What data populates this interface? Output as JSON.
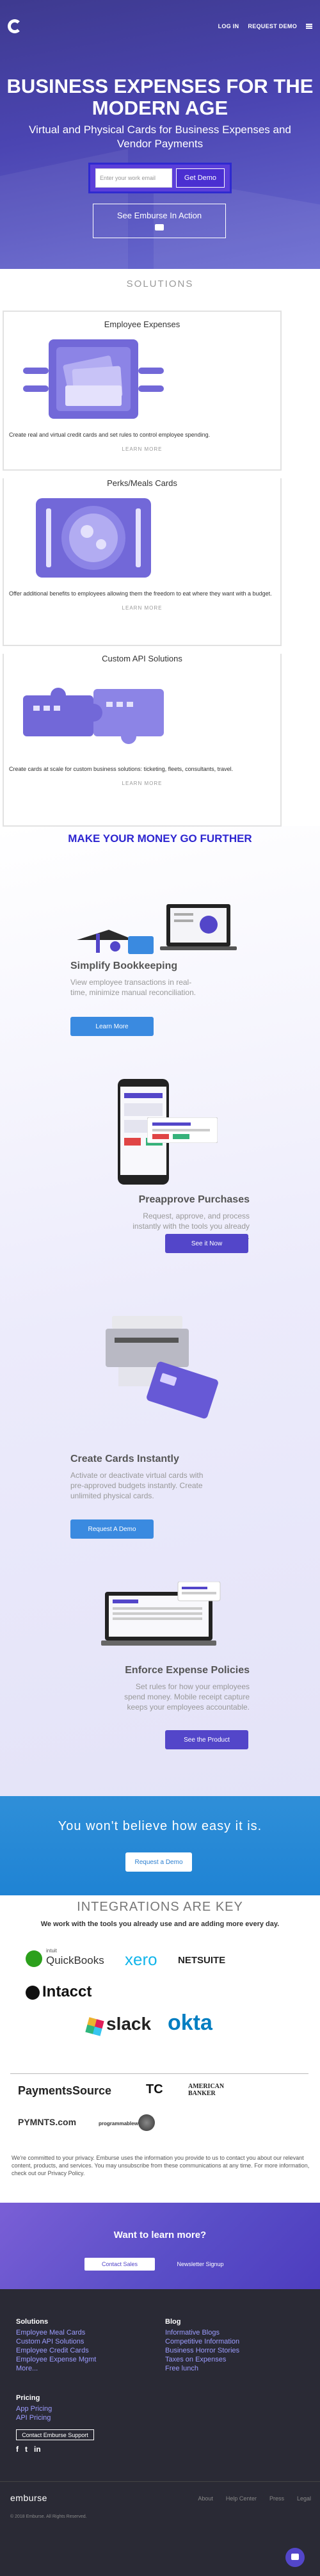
{
  "nav": {
    "login": "LOG IN",
    "request_demo": "REQUEST DEMO"
  },
  "hero": {
    "title": "BUSINESS EXPENSES FOR THE MODERN AGE",
    "subtitle": "Virtual and Physical Cards for Business Expenses and Vendor Payments",
    "email_placeholder": "Enter your work email",
    "get_demo": "Get Demo",
    "see_action": "See Emburse In Action"
  },
  "solutions": {
    "title": "SOLUTIONS",
    "cards": [
      {
        "title": "Employee Expenses",
        "desc": "Create real and virtual credit cards and set rules to control employee spending.",
        "learn": "LEARN MORE"
      },
      {
        "title": "Perks/Meals Cards",
        "desc": "Offer additional benefits to employees allowing them the freedom to eat where they want with a budget.",
        "learn": "LEARN MORE"
      },
      {
        "title": "Custom API Solutions",
        "desc": "Create cards at scale for custom business solutions: ticketing, fleets, consultants, travel.",
        "learn": "LEARN MORE"
      }
    ]
  },
  "features": {
    "title": "MAKE YOUR MONEY GO FURTHER",
    "items": [
      {
        "title": "Simplify Bookkeeping",
        "desc": "View employee transactions in real-time, minimize manual reconciliation.",
        "button": "Learn More"
      },
      {
        "title": "Preapprove Purchases",
        "desc": "Request, approve, and process instantly with the tools you already use.",
        "button": "See it Now"
      },
      {
        "title": "Create Cards Instantly",
        "desc": "Activate or deactivate virtual cards with pre-approved budgets instantly. Create unlimited physical cards.",
        "button": "Request A Demo"
      },
      {
        "title": "Enforce Expense Policies",
        "desc": "Set rules for how your employees spend money. Mobile receipt capture keeps your employees accountable.",
        "button": "See the Product"
      }
    ]
  },
  "easy": {
    "title": "You won't believe how easy it is.",
    "button": "Request a Demo"
  },
  "integrations": {
    "title": "INTEGRATIONS ARE KEY",
    "subtitle": "We work with the tools you already use and are adding more every day.",
    "logos": [
      "QuickBooks",
      "xero",
      "NETSUITE",
      "Intacct",
      "slack",
      "okta"
    ],
    "quickbooks_prefix": "intuit"
  },
  "press": {
    "logos": [
      "PaymentsSource",
      "TC",
      "AMERICAN BANKER",
      "PYMNTS.com",
      "programmableweb"
    ]
  },
  "cookie": "We're committed to your privacy. Emburse uses the information you provide to us to contact you about our relevant content, products, and services. You may unsubscribe from these communications at any time. For more information, check out our Privacy Policy.",
  "learn_more": {
    "title": "Want to learn more?",
    "contact_sales": "Contact Sales",
    "newsletter": "Newsletter Signup"
  },
  "footer": {
    "solutions_title": "Solutions",
    "solutions": [
      "Employee Meal Cards",
      "Custom API Solutions",
      "Employee Credit Cards",
      "Employee Expense Mgmt",
      "More..."
    ],
    "blog_title": "Blog",
    "blog": [
      "Informative Blogs",
      "Competitive Information",
      "Business Horror Stories",
      "Taxes on Expenses",
      "Free lunch"
    ],
    "pricing_title": "Pricing",
    "pricing": [
      "App Pricing",
      "API Pricing"
    ],
    "contact_support": "Contact Emburse Support",
    "logo": "emburse",
    "links": [
      "About",
      "Help Center",
      "Press",
      "Legal"
    ],
    "copyright": "© 2018 Emburse. All Rights Reserved."
  }
}
